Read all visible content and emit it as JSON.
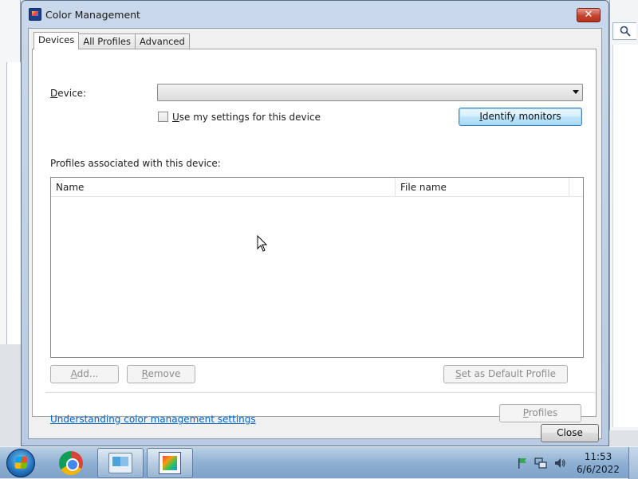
{
  "window": {
    "title": "Color Management",
    "close_glyph": "✕"
  },
  "tabs": [
    {
      "label": "Devices"
    },
    {
      "label": "All Profiles"
    },
    {
      "label": "Advanced"
    }
  ],
  "device": {
    "label_prefix": "D",
    "label_rest": "evice:",
    "selected_value": ""
  },
  "use_settings": {
    "label_prefix": "U",
    "label_rest": "se my settings for this device",
    "checked": false
  },
  "identify_button": {
    "label_prefix": "I",
    "label_rest": "dentify monitors"
  },
  "profiles_label": "Profiles associated with this device:",
  "profiles_table": {
    "columns": [
      "Name",
      "File name"
    ],
    "rows": []
  },
  "buttons": {
    "add_prefix": "A",
    "add_rest": "dd...",
    "remove_prefix": "R",
    "remove_rest": "emove",
    "default_prefix": "S",
    "default_rest": "et as Default Profile",
    "profiles_prefix": "P",
    "profiles_rest": "rofiles",
    "close": "Close"
  },
  "help_link": "Understanding color management settings",
  "taskbar": {
    "time": "11:53",
    "date": "6/6/2022"
  },
  "colors": {
    "accent": "#0066cc",
    "title_bar": "#c9d8ea",
    "taskbar": "#8fb0d2"
  }
}
